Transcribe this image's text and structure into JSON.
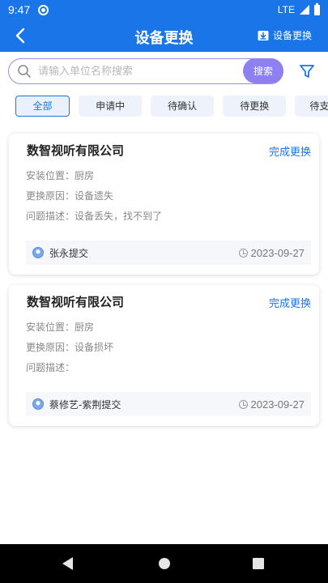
{
  "status_bar": {
    "time": "9:47",
    "network": "LTE"
  },
  "header": {
    "title": "设备更换",
    "action_label": "设备更换"
  },
  "search": {
    "placeholder": "请输入单位名称搜索",
    "button_label": "搜索"
  },
  "tabs": [
    {
      "label": "全部",
      "active": true
    },
    {
      "label": "申请中"
    },
    {
      "label": "待确认"
    },
    {
      "label": "待更换"
    },
    {
      "label": "待支"
    }
  ],
  "cards": [
    {
      "company": "数智视听有限公司",
      "action": "完成更换",
      "install_location_label": "安装位置：",
      "install_location": "厨房",
      "reason_label": "更换原因：",
      "reason": "设备遗失",
      "problem_label": "问题描述：",
      "problem": "设备丢失，找不到了",
      "submitter": "张永提交",
      "date": "2023-09-27"
    },
    {
      "company": "数智视听有限公司",
      "action": "完成更换",
      "install_location_label": "安装位置：",
      "install_location": "厨房",
      "reason_label": "更换原因：",
      "reason": "设备损坏",
      "problem_label": "问题描述：",
      "problem": "",
      "submitter": "蔡修艺-紫荆提交",
      "date": "2023-09-27"
    }
  ],
  "colors": {
    "primary": "#1a76e8",
    "search_button": "#8f80f2",
    "search_border": "#9d8de8"
  }
}
